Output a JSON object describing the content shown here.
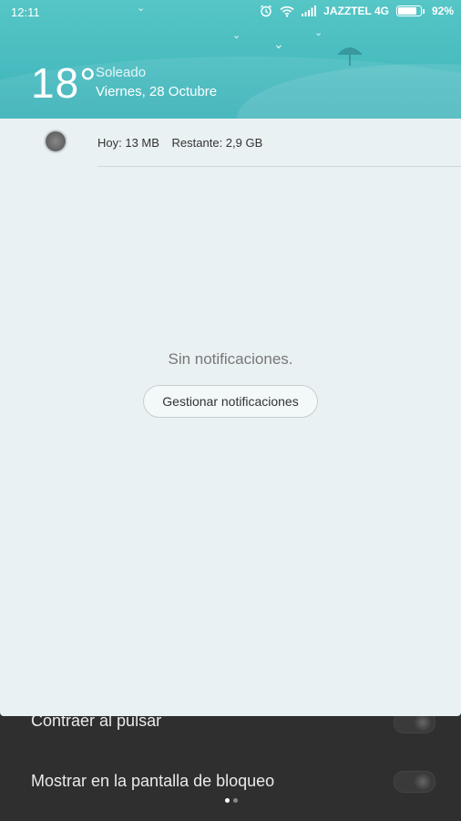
{
  "status_bar": {
    "time": "12:11",
    "carrier": "JAZZTEL 4G",
    "battery_text": "92%",
    "battery_level": 0.92,
    "icons": [
      "alarm-icon",
      "wifi-icon",
      "signal-icon",
      "battery-icon"
    ]
  },
  "weather": {
    "temperature": "18°",
    "condition": "Soleado",
    "date": "Viernes, 28 Octubre",
    "icons": [
      "birds-icon",
      "umbrella-icon"
    ]
  },
  "data_usage": {
    "today": "Hoy: 13 MB",
    "remaining": "Restante: 2,9 GB",
    "icon": "data-usage-icon"
  },
  "notifications": {
    "empty_text": "Sin notificaciones.",
    "manage_button": "Gestionar notificaciones"
  },
  "background_settings": {
    "items": [
      {
        "label": "Contraer al pulsar",
        "toggle_on": false
      },
      {
        "label": "Mostrar en la pantalla de bloqueo",
        "toggle_on": false
      }
    ]
  },
  "page_indicator": {
    "total": 2,
    "current": 1
  },
  "colors": {
    "header_teal": "#48bcc0",
    "panel_bg": "#eaf1f3",
    "backdrop": "#2f2f2f"
  }
}
